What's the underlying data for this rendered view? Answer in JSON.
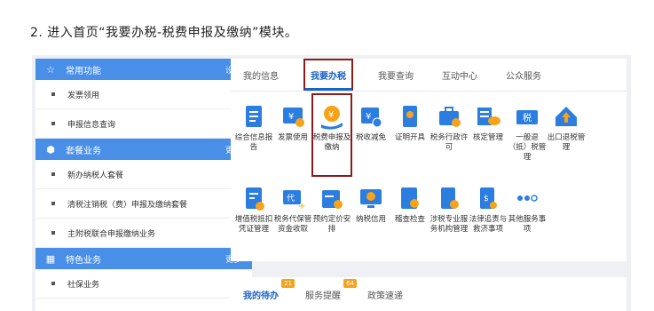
{
  "instruction": "2. 进入首页“我要办税-税费申报及缴纳”模块。",
  "sidebar": {
    "sections": [
      {
        "title": "常用功能",
        "action": "设置",
        "items": [
          "发票领用",
          "申报信息查询"
        ]
      },
      {
        "title": "套餐业务",
        "action": "更多",
        "items": [
          "新办纳税人套餐",
          "清税注销税（费）申报及缴纳套餐",
          "主附税联合申报缴纳业务"
        ]
      },
      {
        "title": "特色业务",
        "action": "更多",
        "items": [
          "社保业务"
        ]
      }
    ]
  },
  "tabs": [
    "我的信息",
    "我要办税",
    "我要查询",
    "互动中心",
    "公众服务"
  ],
  "active_tab": 1,
  "grid": {
    "row1": [
      "综合信息报告",
      "发票使用",
      "税费申报及缴纳",
      "税收减免",
      "证明开具",
      "税务行政许可",
      "核定管理",
      "一般退（抵）税管理",
      "出口退税管理"
    ],
    "row2": [
      "增值税抵扣凭证管理",
      "税务代保管资金收取",
      "预约定价安排",
      "纳税信用",
      "稽查检查",
      "涉税专业服务机构管理",
      "法律追责与救济事项",
      "其他服务事项"
    ]
  },
  "todo_tabs": [
    {
      "label": "我的待办",
      "badge": "21"
    },
    {
      "label": "服务提醒",
      "badge": "64"
    },
    {
      "label": "政策速递",
      "badge": ""
    }
  ],
  "colors": {
    "accent": "#4a8fe7",
    "highlight": "#8b1a1a",
    "blue": "#2b7de0",
    "orange": "#f6a21a"
  }
}
